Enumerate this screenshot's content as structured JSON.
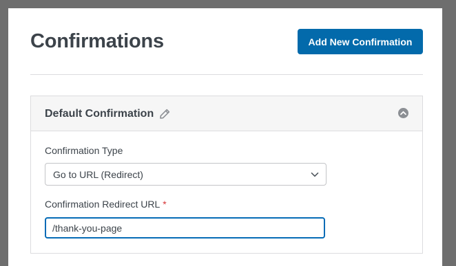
{
  "header": {
    "title": "Confirmations",
    "add_button_label": "Add New Confirmation"
  },
  "panel": {
    "title": "Default Confirmation",
    "edit_icon": "pencil-icon",
    "collapse_icon": "chevron-up-circle-icon",
    "fields": {
      "type": {
        "label": "Confirmation Type",
        "selected_value": "Go to URL (Redirect)"
      },
      "redirect_url": {
        "label": "Confirmation Redirect URL",
        "required_marker": "*",
        "value": "/thank-you-page"
      }
    }
  },
  "colors": {
    "accent": "#036aab",
    "required": "#d63638",
    "text": "#3c434a",
    "focus_border": "#056bb6"
  }
}
